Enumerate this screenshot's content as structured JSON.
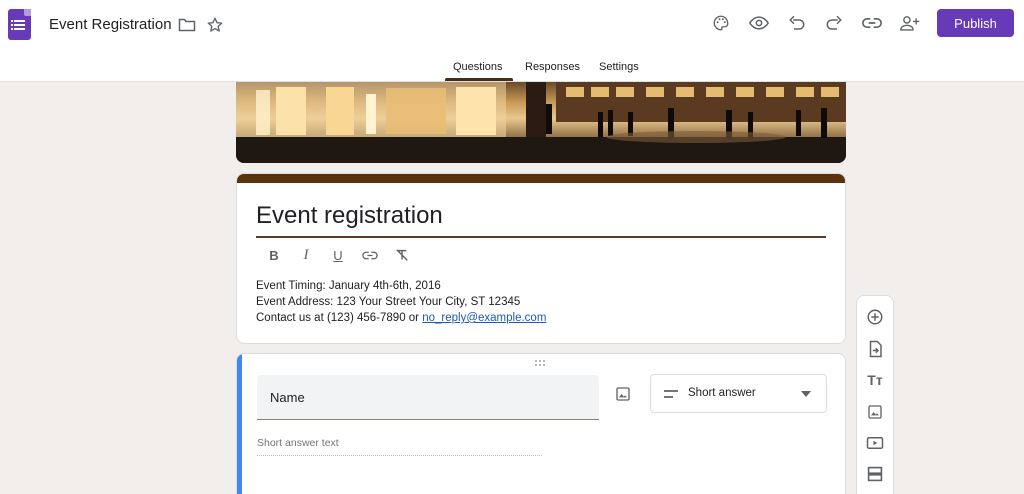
{
  "header": {
    "doc_title": "Event Registration",
    "publish_label": "Publish"
  },
  "tabs": [
    {
      "label": "Questions",
      "active": true
    },
    {
      "label": "Responses"
    },
    {
      "label": "Settings"
    }
  ],
  "form": {
    "title": "Event registration",
    "description_lines": [
      "Event Timing: January 4th-6th, 2016",
      "Event Address: 123 Your Street Your City, ST 12345"
    ],
    "contact_prefix": "Contact us at (123) 456-7890 or ",
    "contact_email": "no_reply@example.com"
  },
  "question": {
    "title": "Name",
    "type": "Short answer",
    "answer_hint": "Short answer text"
  },
  "colors": {
    "accent": "#673ab7",
    "theme": "#5a320b",
    "focus_bar": "#4285f4"
  },
  "icons": {
    "toolbar": [
      "palette-icon",
      "preview-icon",
      "undo-icon",
      "redo-icon",
      "link-icon",
      "add-collaborator-icon"
    ],
    "format": [
      "bold-icon",
      "italic-icon",
      "underline-icon",
      "link-icon",
      "clear-format-icon"
    ],
    "side": [
      "add-question-icon",
      "import-questions-icon",
      "add-title-icon",
      "add-image-icon",
      "add-video-icon",
      "add-section-icon"
    ]
  }
}
